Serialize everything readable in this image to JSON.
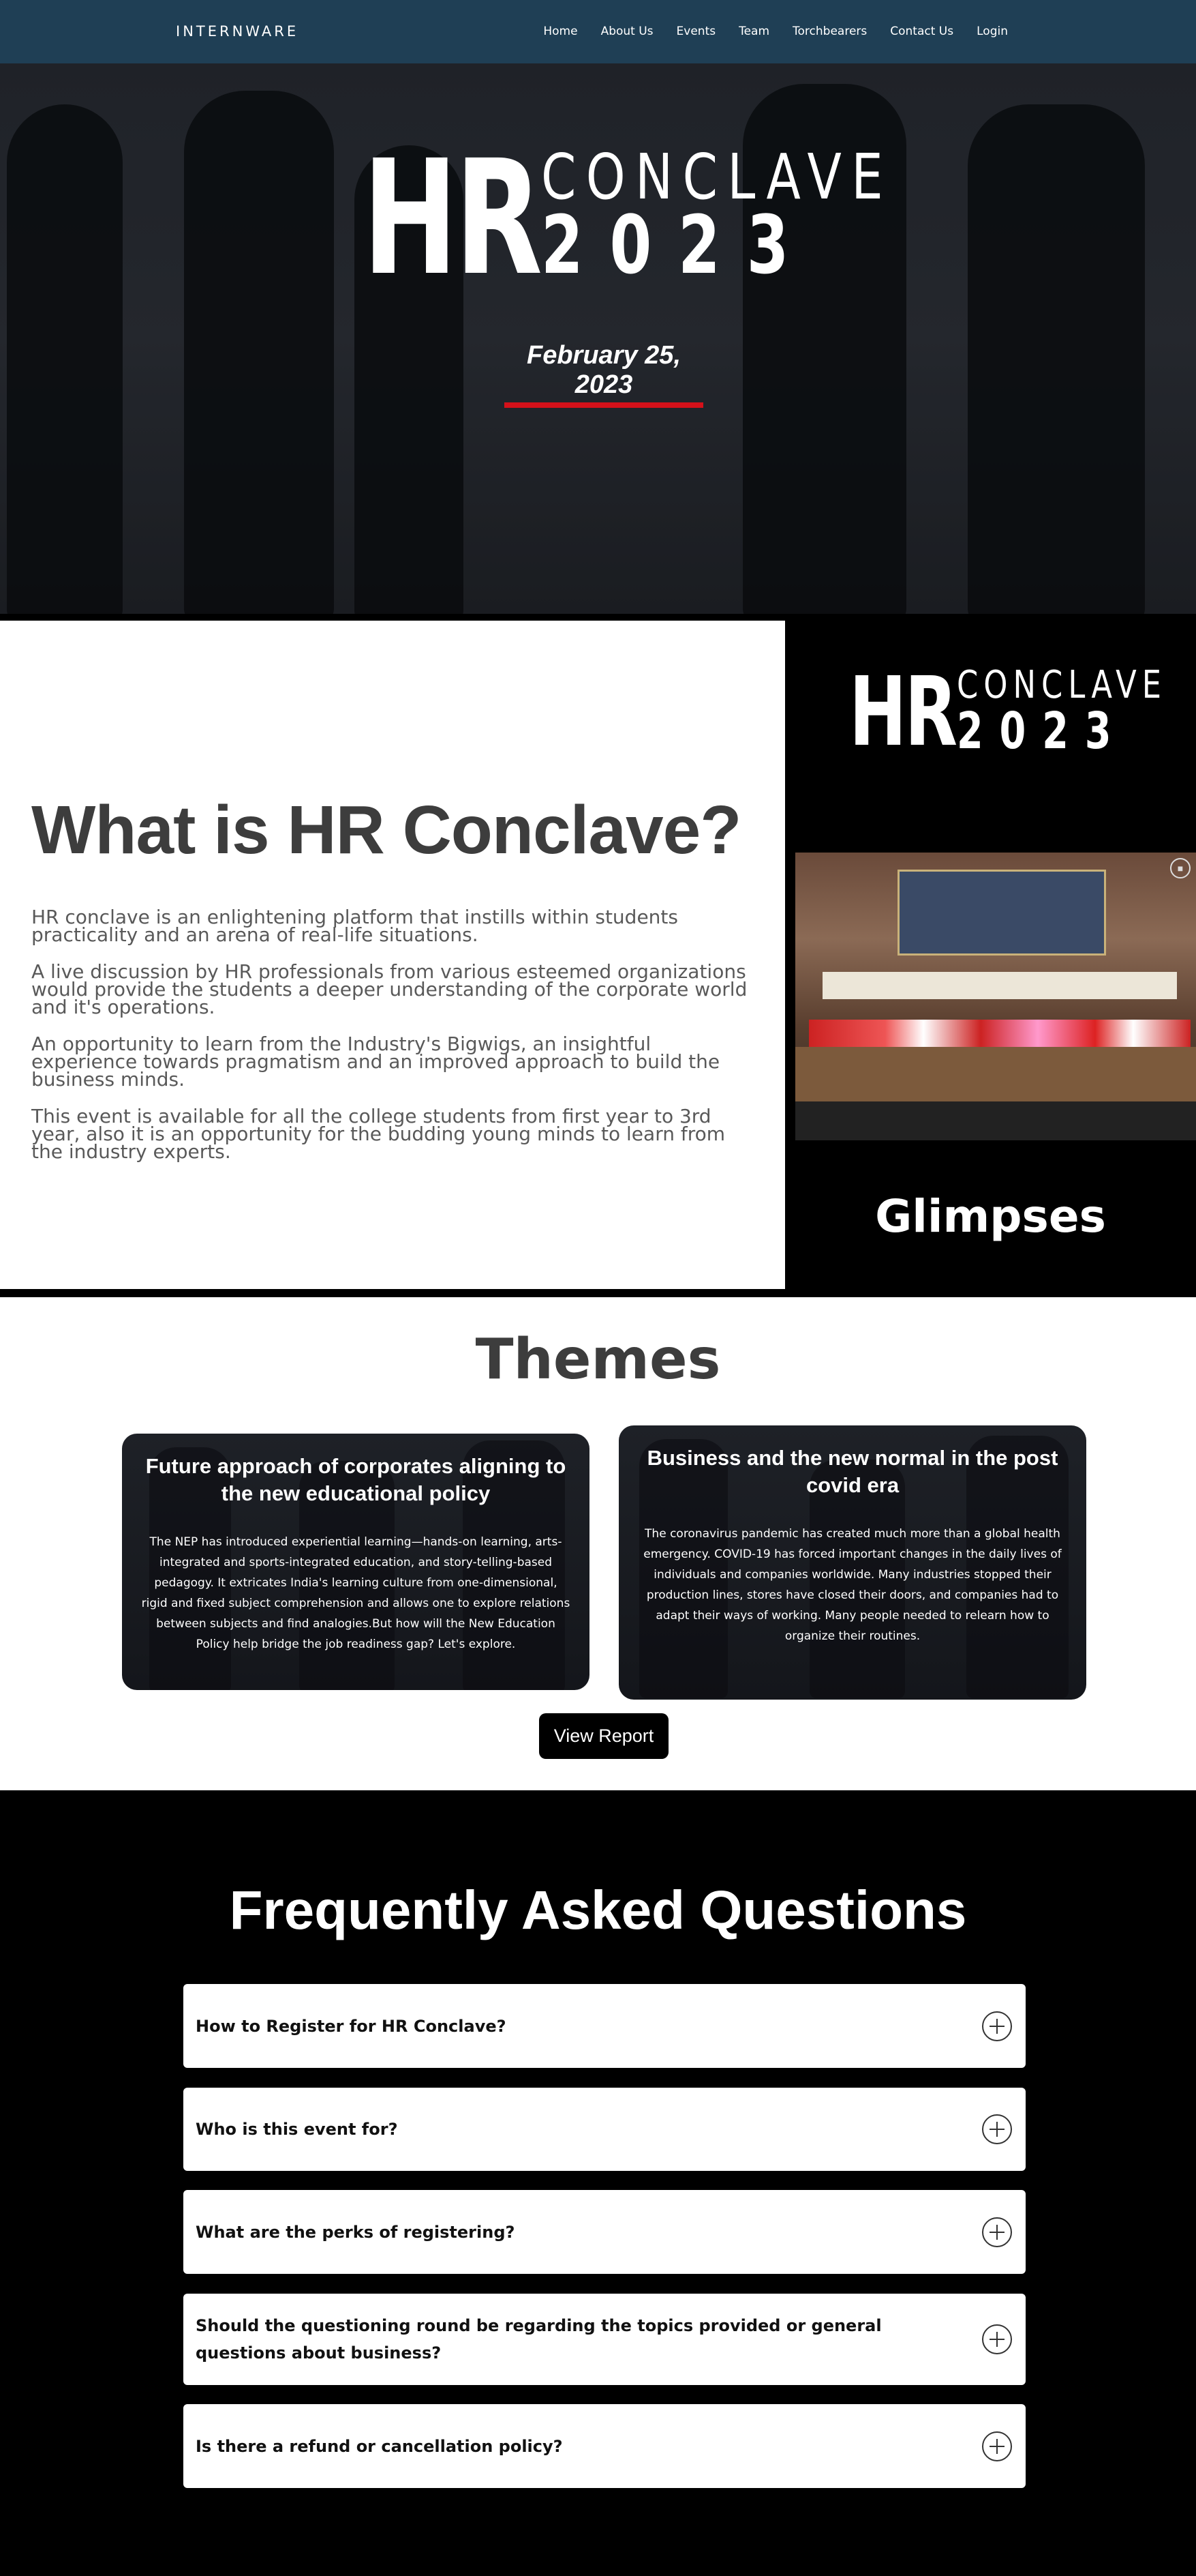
{
  "nav": {
    "brand": "INTERNWARE",
    "links": [
      "Home",
      "About Us",
      "Events",
      "Team",
      "Torchbearers",
      "Contact Us",
      "Login"
    ]
  },
  "hero": {
    "logo_hr": "HR",
    "logo_conclave": "CONCLAVE",
    "logo_year": "2023",
    "date": "February 25, 2023"
  },
  "about": {
    "title": "What is HR Conclave?",
    "paragraphs": [
      "HR conclave is an enlightening platform that instills within students practicality and an arena of real-life situations.",
      "A live discussion by HR professionals from various esteemed organizations would provide the students a deeper understanding of the corporate world and it's operations.",
      "An opportunity to learn from the Industry's Bigwigs, an insightful experience towards pragmatism and an improved approach to build the business minds.",
      "This event is available for all the college students from first year to 3rd year, also it is an opportunity for the budding young minds to learn from the industry experts."
    ]
  },
  "side": {
    "glimpses_title": "Glimpses"
  },
  "themes": {
    "title": "Themes",
    "cards": [
      {
        "title": "Future approach of corporates aligning to the new educational policy",
        "body": "The NEP has introduced experiential learning—hands-on learning, arts-integrated and sports-integrated education, and story-telling-based pedagogy. It extricates India's learning culture from one-dimensional, rigid and fixed subject comprehension and allows one to explore relations between subjects and find analogies.But how will the New Education Policy help bridge the job readiness gap? Let's explore."
      },
      {
        "title": "Business and the new normal in the post covid era",
        "body": "The coronavirus pandemic has created much more than a global health emergency. COVID-19 has forced important changes in the daily lives of individuals and companies worldwide. Many industries stopped their production lines, stores have closed their doors, and companies had to adapt their ways of working. Many people needed to relearn how to organize their routines."
      }
    ],
    "button_label": "View Report"
  },
  "faq": {
    "title": "Frequently Asked Questions",
    "items": [
      "How to Register for HR Conclave?",
      "Who is this event for?",
      "What are the perks of registering?",
      "Should the questioning round be regarding the topics provided or general questions about business?",
      "Is there a refund or cancellation policy?"
    ]
  },
  "colors": {
    "nav_bg": "#1f3f55",
    "date_underline": "#d4111a",
    "heading_gray": "#3d3d3d"
  }
}
